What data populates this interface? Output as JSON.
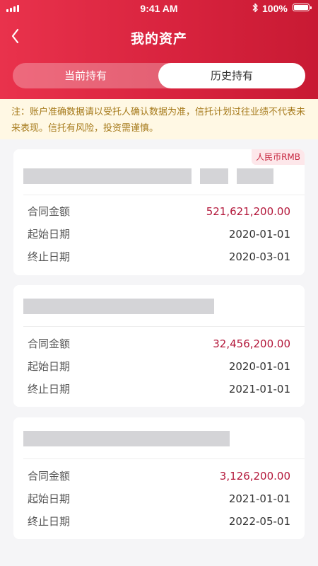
{
  "status_bar": {
    "time": "9:41 AM",
    "battery": "100%",
    "battery_level": 1.0
  },
  "header": {
    "title": "我的资产"
  },
  "tabs": [
    {
      "label": "当前持有",
      "active": false
    },
    {
      "label": "历史持有",
      "active": true
    }
  ],
  "notice": "注：账户准确数据请以受托人确认数据为准，信托计划过往业绩不代表未来表现。信托有风险，投资需谨慎。",
  "labels": {
    "amount": "合同金额",
    "start": "起始日期",
    "end": "终止日期"
  },
  "cards": [
    {
      "badge": "人民币RMB",
      "amount": "521,621,200.00",
      "start": "2020-01-01",
      "end": "2020-03-01"
    },
    {
      "amount": "32,456,200.00",
      "start": "2020-01-01",
      "end": "2021-01-01"
    },
    {
      "amount": "3,126,200.00",
      "start": "2021-01-01",
      "end": "2022-05-01"
    }
  ],
  "colors": {
    "brand": "#d8233e",
    "amount": "#b3173a",
    "notice_text": "#a67a1b",
    "notice_bg": "#fff8e4"
  }
}
